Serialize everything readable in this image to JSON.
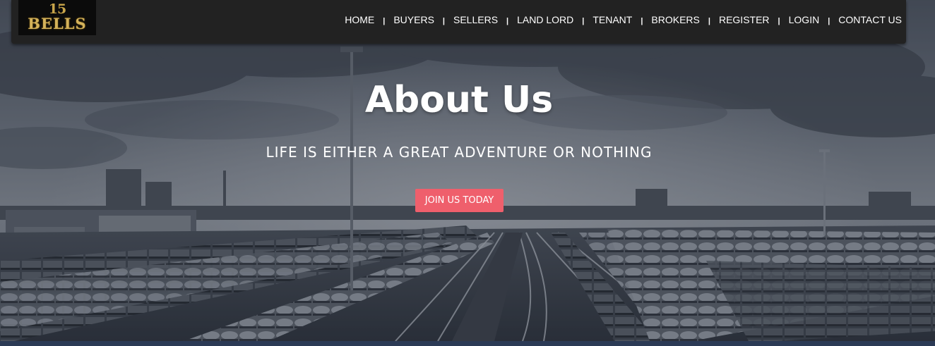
{
  "brand": {
    "logo_number": "15",
    "logo_word": "BELLS"
  },
  "nav": {
    "separator": "|",
    "items": [
      {
        "label": "HOME"
      },
      {
        "label": "BUYERS"
      },
      {
        "label": "SELLERS"
      },
      {
        "label": "LAND LORD"
      },
      {
        "label": "TENANT"
      },
      {
        "label": "BROKERS"
      },
      {
        "label": "REGISTER"
      },
      {
        "label": "LOGIN"
      },
      {
        "label": "CONTACT US"
      }
    ]
  },
  "hero": {
    "title": "About Us",
    "subtitle": "LIFE IS EITHER A GREAT ADVENTURE OR NOTHING",
    "cta_label": "JOIN US TODAY"
  },
  "colors": {
    "navbar": "#222222",
    "cta": "#ef5f6c",
    "logo_gold": "#d4b25a",
    "footer_strip": "#2b3a55"
  }
}
